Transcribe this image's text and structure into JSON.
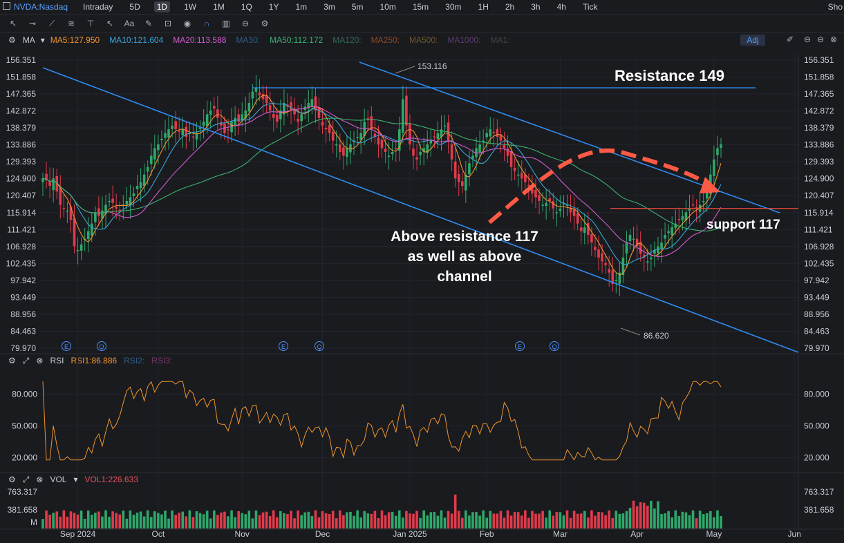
{
  "symbol": "NVDA:Nasdaq",
  "timeframes": [
    "Intraday",
    "5D",
    "1D",
    "1W",
    "1M",
    "1Q",
    "1Y",
    "1m",
    "3m",
    "5m",
    "10m",
    "15m",
    "30m",
    "1H",
    "2h",
    "3h",
    "4h",
    "Tick"
  ],
  "active_timeframe": "1D",
  "right_clip_label": "Sho",
  "ma_indicators": {
    "label": "MA",
    "items": [
      {
        "text": "MA5:127.950",
        "color": "#f0952e"
      },
      {
        "text": "MA10:121.604",
        "color": "#3aa6d8"
      },
      {
        "text": "MA20:113.588",
        "color": "#d45ad0"
      },
      {
        "text": "MA30:",
        "color": "#2f5b8a"
      },
      {
        "text": "MA50:112.172",
        "color": "#3cb371"
      },
      {
        "text": "MA120:",
        "color": "#2e6b5a"
      },
      {
        "text": "MA250:",
        "color": "#8a4a2c"
      },
      {
        "text": "MA500:",
        "color": "#6b5a2a"
      },
      {
        "text": "MA1000:",
        "color": "#5a3a6b"
      },
      {
        "text": "MA1:",
        "color": "#444"
      }
    ],
    "adj_label": "Adj"
  },
  "rsi_panel": {
    "label": "RSI",
    "items": [
      {
        "text": "RSI1:86.886",
        "color": "#f0952e"
      },
      {
        "text": "RSI2:",
        "color": "#2f5b8a"
      },
      {
        "text": "RSI3:",
        "color": "#7a3a6b"
      }
    ]
  },
  "vol_panel": {
    "label": "VOL",
    "items": [
      {
        "text": "VOL1:226.633",
        "color": "#e8515a"
      }
    ]
  },
  "colors": {
    "up": "#2fa86b",
    "down": "#e03b4b",
    "channel": "#2e8cf0",
    "resistance": "#2e8cf0",
    "support": "#e04a3a",
    "arrow": "#ff5a45"
  },
  "chart_data": [
    {
      "type": "candlestick",
      "title": "NVDA daily",
      "ylim": [
        79.97,
        156.351
      ],
      "y_ticks": [
        "156.351",
        "151.858",
        "147.365",
        "142.872",
        "138.379",
        "133.886",
        "129.393",
        "124.900",
        "120.407",
        "115.914",
        "111.421",
        "106.928",
        "102.435",
        "97.942",
        "93.449",
        "88.956",
        "84.463",
        "79.970"
      ],
      "x_ticks": [
        "Sep 2024",
        "Oct",
        "Nov",
        "Dec",
        "Jan 2025",
        "Feb",
        "Mar",
        "Apr",
        "May",
        "Jun"
      ],
      "price_labels": [
        {
          "text": "153.116",
          "value": 153.116
        },
        {
          "text": "86.620",
          "value": 86.62
        }
      ],
      "event_markers": [
        "E",
        "Q",
        "E",
        "Q",
        "E",
        "Q"
      ],
      "closes": [
        125,
        124.5,
        123,
        125,
        121.5,
        118,
        117,
        116.5,
        114,
        107,
        106,
        107.5,
        109,
        111,
        113,
        116,
        115,
        116.5,
        118,
        119,
        118.5,
        117,
        116.5,
        118,
        119,
        120,
        121,
        123,
        124,
        126,
        128,
        131,
        133,
        134,
        135.5,
        137,
        138,
        139,
        138,
        137.5,
        138,
        136,
        137,
        136,
        137,
        138.5,
        140,
        142,
        143,
        143.5,
        141,
        139,
        137,
        138,
        140,
        141,
        140,
        142,
        143,
        145,
        148,
        149,
        147,
        146,
        145,
        143,
        141,
        140,
        143,
        145,
        144,
        143,
        142,
        140,
        142,
        144,
        145,
        146,
        143,
        141,
        139,
        138,
        137,
        135,
        134,
        132,
        131,
        133,
        134,
        135,
        136,
        137,
        140,
        141,
        138,
        136,
        134,
        133,
        132,
        131,
        132,
        133,
        138,
        146,
        139,
        134,
        131,
        130,
        132,
        133,
        134,
        135,
        136,
        137,
        138,
        139,
        135,
        130,
        125,
        124,
        123,
        126,
        129,
        131,
        133,
        134,
        135,
        137,
        138,
        137,
        136,
        135,
        133,
        131,
        128,
        127,
        126,
        125,
        124,
        123,
        121,
        120,
        119,
        118,
        118.5,
        119,
        117,
        116,
        117,
        118.5,
        118,
        116,
        115,
        113,
        111,
        112,
        110,
        108,
        106,
        104,
        103,
        102,
        100,
        97,
        98,
        100,
        104,
        108,
        110,
        109,
        107,
        105,
        104,
        103,
        104,
        106,
        107,
        108,
        110,
        111,
        112,
        113,
        114,
        115,
        116,
        117,
        118,
        117,
        118,
        119,
        122,
        126,
        130,
        133,
        134
      ],
      "rsi": {
        "ylim": [
          10,
          100
        ],
        "ticks": [
          "80.000",
          "50.000",
          "20.000"
        ],
        "last": 86.886
      },
      "volume": {
        "ticks": [
          "763.317",
          "381.658",
          "M"
        ],
        "max": 763.317
      },
      "annotations": [
        {
          "text": "Resistance 149",
          "value": 149
        },
        {
          "text": "support 117",
          "value": 117
        },
        {
          "text": "Above resistance 117",
          "line": 1
        },
        {
          "text": "as well as above",
          "line": 2
        },
        {
          "text": "channel",
          "line": 3
        }
      ]
    }
  ]
}
